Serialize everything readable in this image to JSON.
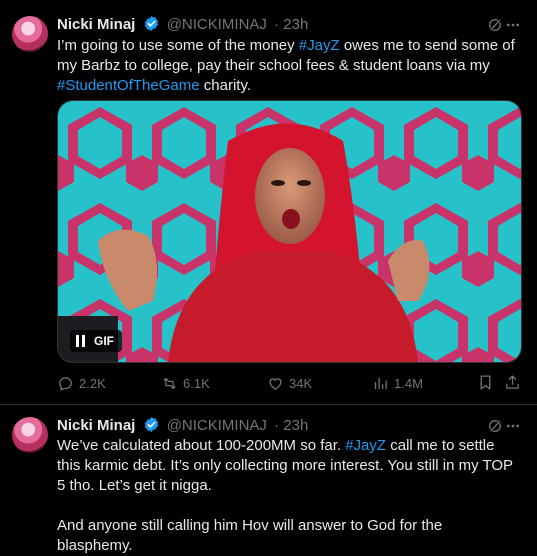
{
  "tweets": [
    {
      "author": {
        "name": "Nicki Minaj",
        "handle": "@NICKIMINAJ",
        "time": "· 23h",
        "verified": true
      },
      "text_parts": [
        {
          "t": "I’m going to use some of the money "
        },
        {
          "t": "#JayZ",
          "tag": true
        },
        {
          "t": " owes me to send some of my Barbz to college, pay their school fees & student loans via my "
        },
        {
          "t": "#StudentOfTheGame",
          "tag": true
        },
        {
          "t": " charity."
        }
      ],
      "media": {
        "type": "gif",
        "badge": "GIF",
        "control_icon": "pause-icon"
      },
      "stats": {
        "replies": "2.2K",
        "reposts": "6.1K",
        "likes": "34K",
        "views": "1.4M"
      }
    },
    {
      "author": {
        "name": "Nicki Minaj",
        "handle": "@NICKIMINAJ",
        "time": "· 23h",
        "verified": true
      },
      "text_parts": [
        {
          "t": "We’ve calculated about 100-200MM so far.  "
        },
        {
          "t": "#JayZ",
          "tag": true
        },
        {
          "t": " call me to settle this karmic debt. It’s only collecting more interest. You still in my TOP 5 tho. Let’s get it nigga.\n\nAnd anyone still calling him Hov will answer to God for the blasphemy."
        }
      ]
    }
  ],
  "colors": {
    "background": "#000000",
    "text": "#e7e9ea",
    "muted": "#71767b",
    "accent": "#1d9bf0",
    "verified": "#1d9bf0"
  }
}
